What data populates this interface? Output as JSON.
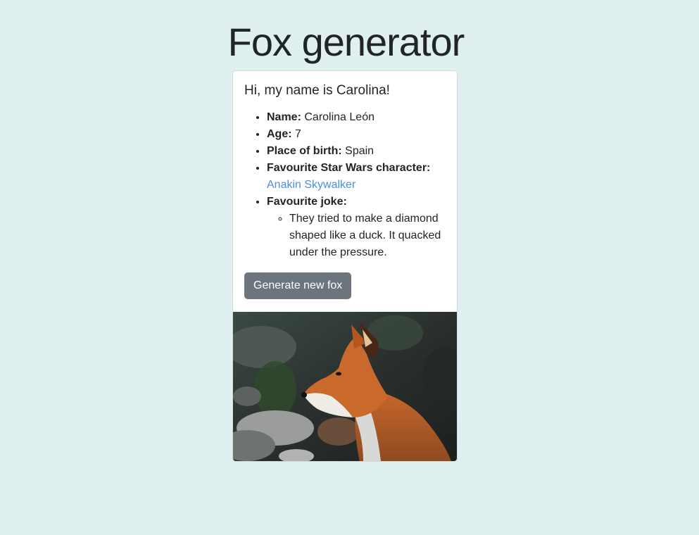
{
  "page": {
    "title": "Fox generator"
  },
  "card": {
    "heading": "Hi, my name is Carolina!",
    "name_label": "Name:",
    "name_value": "Carolina León",
    "age_label": "Age:",
    "age_value": "7",
    "birth_label": "Place of birth:",
    "birth_value": "Spain",
    "sw_label": "Favourite Star Wars character:",
    "sw_value": "Anakin Skywalker",
    "joke_label": "Favourite joke:",
    "joke_value": "They tried to make a diamond shaped like a duck. It quacked under the pressure.",
    "button_label": "Generate new fox",
    "photo_icon": "fox-photo"
  },
  "colors": {
    "background": "#e0f0f0",
    "link": "#4a8fe0",
    "button": "#6c757d"
  }
}
